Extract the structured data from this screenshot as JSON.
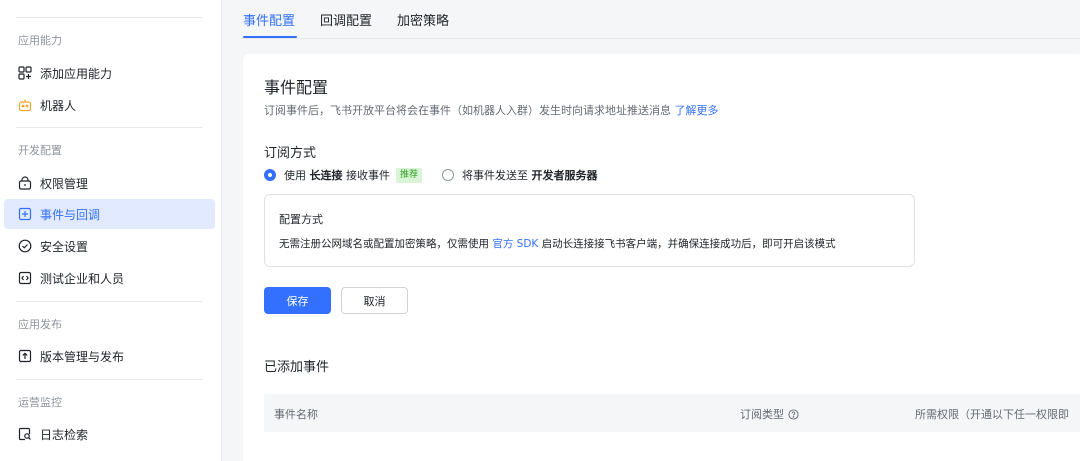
{
  "sidebar": {
    "sections": [
      {
        "title": "应用能力",
        "items": [
          {
            "label": "添加应用能力",
            "icon": "apps-grid-icon"
          },
          {
            "label": "机器人",
            "icon": "robot-icon"
          }
        ]
      },
      {
        "title": "开发配置",
        "items": [
          {
            "label": "权限管理",
            "icon": "lock-icon"
          },
          {
            "label": "事件与回调",
            "icon": "event-icon",
            "active": true
          },
          {
            "label": "安全设置",
            "icon": "shield-icon"
          },
          {
            "label": "测试企业和人员",
            "icon": "test-icon"
          }
        ]
      },
      {
        "title": "应用发布",
        "items": [
          {
            "label": "版本管理与发布",
            "icon": "upload-icon"
          }
        ]
      },
      {
        "title": "运营监控",
        "items": [
          {
            "label": "日志检索",
            "icon": "log-search-icon"
          }
        ]
      }
    ]
  },
  "tabs": [
    {
      "label": "事件配置",
      "active": true
    },
    {
      "label": "回调配置"
    },
    {
      "label": "加密策略"
    }
  ],
  "event_config": {
    "title": "事件配置",
    "description": "订阅事件后，飞书开放平台将会在事件（如机器人入群）发生时向请求地址推送消息",
    "description_link": "了解更多",
    "subscribe_title": "订阅方式",
    "option1_prefix": "使用",
    "option1_bold": "长连接",
    "option1_suffix": "接收事件",
    "option1_badge": "推荐",
    "option2_prefix": "将事件发送至",
    "option2_bold": "开发者服务器",
    "info_title": "配置方式",
    "info_text_prefix": "无需注册公网域名或配置加密策略，仅需使用",
    "info_text_link": "官方 SDK",
    "info_text_suffix": "启动长连接接飞书客户端，并确保连接成功后，即可开启该模式",
    "save_label": "保存",
    "cancel_label": "取消",
    "added_title": "已添加事件",
    "table_columns": {
      "name": "事件名称",
      "type": "订阅类型",
      "permission": "所需权限（开通以下任一权限即"
    }
  },
  "colors": {
    "accent": "#3370ff",
    "active_bg": "#e1eaff",
    "badge_bg": "#d9f5d6",
    "badge_text": "#2ea121"
  }
}
